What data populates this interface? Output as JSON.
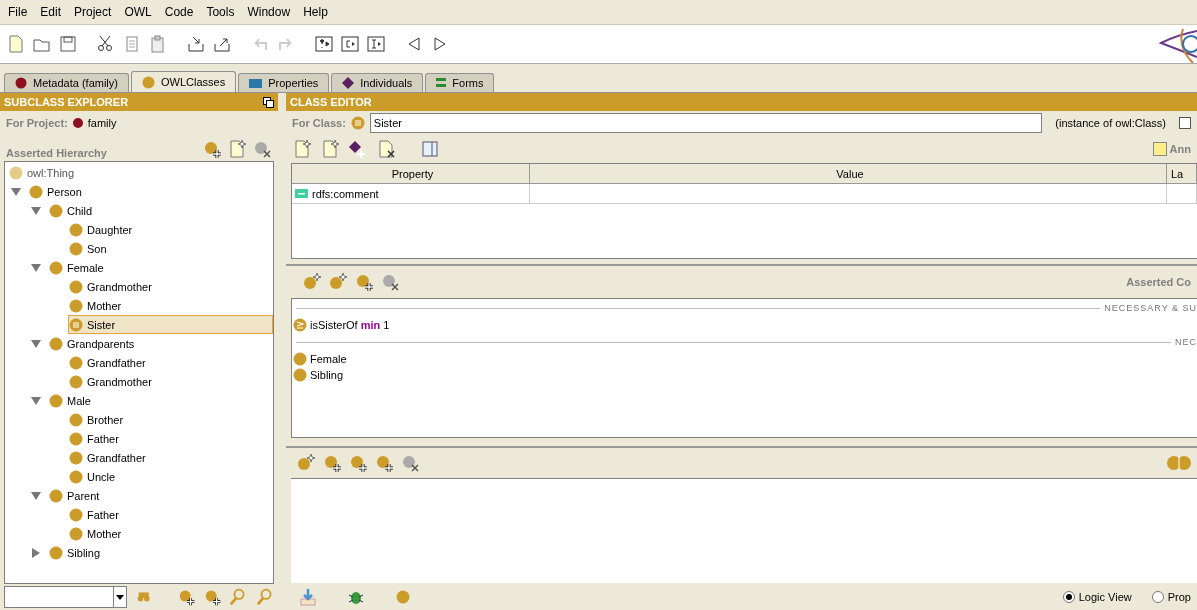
{
  "menu": [
    "File",
    "Edit",
    "Project",
    "OWL",
    "Code",
    "Tools",
    "Window",
    "Help"
  ],
  "tabs": [
    {
      "label": "Metadata (family)",
      "kind": "metadata",
      "selected": false
    },
    {
      "label": "OWLClasses",
      "kind": "classes",
      "selected": true
    },
    {
      "label": "Properties",
      "kind": "properties",
      "selected": false
    },
    {
      "label": "Individuals",
      "kind": "individuals",
      "selected": false
    },
    {
      "label": "Forms",
      "kind": "forms",
      "selected": false
    }
  ],
  "explorer": {
    "title": "SUBCLASS EXPLORER",
    "project_label": "For Project:",
    "project": "family",
    "hierarchy_label": "Asserted Hierarchy",
    "tree": [
      {
        "label": "owl:Thing",
        "kind": "thing",
        "selected": false,
        "children": [
          {
            "label": "Person",
            "kind": "class",
            "selected": false,
            "expanded": true,
            "children": [
              {
                "label": "Child",
                "kind": "class",
                "selected": false,
                "expanded": true,
                "children": [
                  {
                    "label": "Daughter",
                    "kind": "class",
                    "selected": false
                  },
                  {
                    "label": "Son",
                    "kind": "class",
                    "selected": false
                  }
                ]
              },
              {
                "label": "Female",
                "kind": "class",
                "selected": false,
                "expanded": true,
                "children": [
                  {
                    "label": "Grandmother",
                    "kind": "class",
                    "selected": false
                  },
                  {
                    "label": "Mother",
                    "kind": "class",
                    "selected": false
                  },
                  {
                    "label": "Sister",
                    "kind": "defined",
                    "selected": true
                  }
                ]
              },
              {
                "label": "Grandparents",
                "kind": "class",
                "selected": false,
                "expanded": true,
                "children": [
                  {
                    "label": "Grandfather",
                    "kind": "class",
                    "selected": false
                  },
                  {
                    "label": "Grandmother",
                    "kind": "class",
                    "selected": false
                  }
                ]
              },
              {
                "label": "Male",
                "kind": "class",
                "selected": false,
                "expanded": true,
                "children": [
                  {
                    "label": "Brother",
                    "kind": "class",
                    "selected": false
                  },
                  {
                    "label": "Father",
                    "kind": "class",
                    "selected": false
                  },
                  {
                    "label": "Grandfather",
                    "kind": "class",
                    "selected": false
                  },
                  {
                    "label": "Uncle",
                    "kind": "class",
                    "selected": false
                  }
                ]
              },
              {
                "label": "Parent",
                "kind": "class",
                "selected": false,
                "expanded": true,
                "children": [
                  {
                    "label": "Father",
                    "kind": "class",
                    "selected": false
                  },
                  {
                    "label": "Mother",
                    "kind": "class",
                    "selected": false
                  }
                ]
              },
              {
                "label": "Sibling",
                "kind": "class",
                "selected": false,
                "expanded": false
              }
            ]
          }
        ]
      }
    ]
  },
  "editor": {
    "title": "CLASS EDITOR",
    "class_label": "For Class:",
    "class_name": "Sister",
    "instance_of": "(instance of owl:Class)",
    "instance_checked": false,
    "annotations_button": "Ann",
    "table": {
      "columns": [
        "Property",
        "Value",
        "La"
      ],
      "rows": [
        {
          "property": "rdfs:comment"
        }
      ]
    },
    "conditions_title": "Asserted Co",
    "conditions": [
      {
        "kind": "separator",
        "label": "NECESSARY & SU"
      },
      {
        "kind": "restriction",
        "text": "isSisterOf **min** 1"
      },
      {
        "kind": "separator",
        "label": "NEC"
      },
      {
        "kind": "class",
        "text": "Female"
      },
      {
        "kind": "class",
        "text": "Sibling"
      }
    ],
    "views": [
      {
        "label": "Logic View",
        "selected": true
      },
      {
        "label": "Prop",
        "selected": false
      }
    ]
  }
}
